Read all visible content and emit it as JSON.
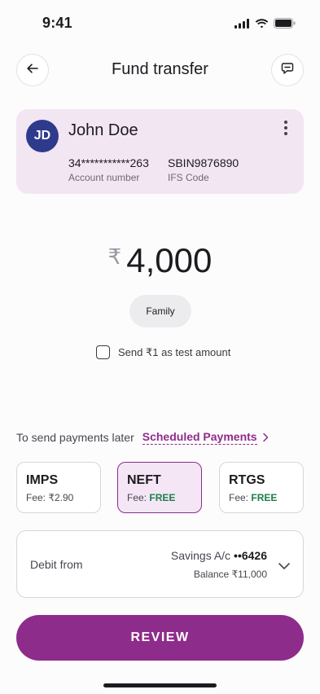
{
  "status_bar": {
    "time": "9:41"
  },
  "header": {
    "title": "Fund transfer"
  },
  "payee": {
    "initials": "JD",
    "name": "John Doe",
    "account_number": "34***********263",
    "account_number_label": "Account number",
    "ifsc": "SBIN9876890",
    "ifsc_label": "IFS Code"
  },
  "amount": {
    "currency_symbol": "₹",
    "value": "4,000"
  },
  "purpose_chip": "Family",
  "test_amount": {
    "label": "Send ₹1 as test amount",
    "checked": false
  },
  "scheduled": {
    "text": "To send payments later",
    "link": "Scheduled Payments"
  },
  "transfer_modes": [
    {
      "name": "IMPS",
      "fee_label": "Fee: ",
      "fee_value": "₹2.90",
      "selected": false
    },
    {
      "name": "NEFT",
      "fee_label": "Fee: ",
      "fee_value": "FREE",
      "selected": true
    },
    {
      "name": "RTGS",
      "fee_label": "Fee: ",
      "fee_value": "FREE",
      "selected": false
    }
  ],
  "debit": {
    "label": "Debit from",
    "account_type": "Savings A/c",
    "masked": "••6426",
    "balance": "Balance ₹11,000"
  },
  "review_button": "REVIEW",
  "colors": {
    "brand": "#8e2c8b",
    "card_bg": "#f3e6f3",
    "avatar": "#2e3a8c",
    "free": "#1a7f4b"
  }
}
